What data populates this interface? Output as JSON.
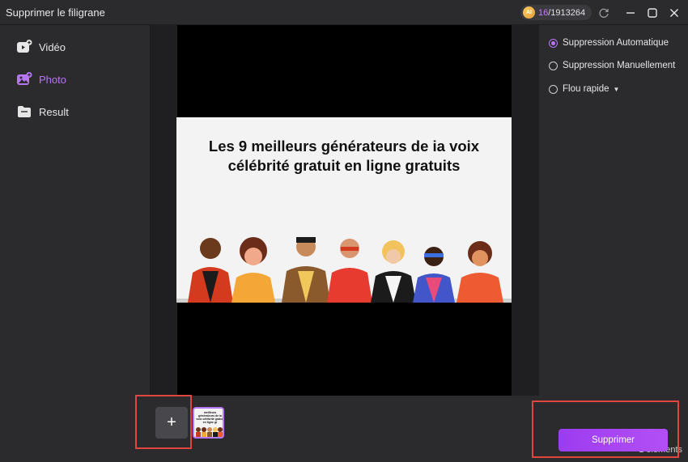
{
  "window": {
    "title": "Supprimer le filigrane",
    "credits_used": "16",
    "credits_total": "/1913264",
    "ai_badge": "AI"
  },
  "sidebar": {
    "items": [
      {
        "label": "Vidéo",
        "icon": "video-plus-icon"
      },
      {
        "label": "Photo",
        "icon": "image-plus-icon",
        "active": true
      },
      {
        "label": "Result",
        "icon": "folder-icon"
      }
    ]
  },
  "preview": {
    "headline_line1": "Les 9 meilleurs générateurs de ia voix",
    "headline_line2": "célébrité gratuit en ligne gratuits"
  },
  "options": [
    {
      "label": "Suppression Automatique",
      "checked": true
    },
    {
      "label": "Suppression Manuellement",
      "checked": false
    },
    {
      "label": "Flou rapide",
      "checked": false,
      "has_dropdown": true
    }
  ],
  "bottom": {
    "add_label": "+",
    "mini_text": "meilleurs générateurs de ia voix célébrité gratuit en ligne gr",
    "count": "1 éléments",
    "remove_label": "Supprimer"
  },
  "colors": {
    "accent": "#b776f4",
    "highlight": "#e0463f",
    "button": "#a244f2"
  }
}
